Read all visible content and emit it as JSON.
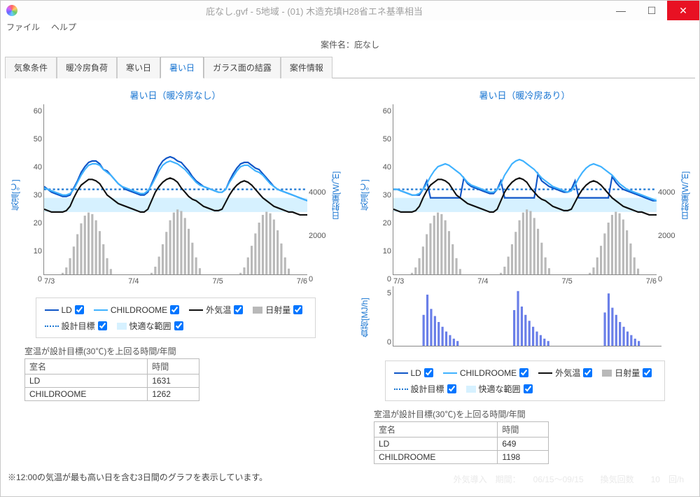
{
  "window": {
    "title": "庇なし.gvf - 5地域 - (01) 木造充填H28省エネ基準相当"
  },
  "menu": {
    "file": "ファイル",
    "help": "ヘルプ"
  },
  "case_label": "案件名：",
  "case_name": "庇なし",
  "tabs": {
    "weather": "気象条件",
    "hvac_load": "暖冷房負荷",
    "cold_day": "寒い日",
    "hot_day": "暑い日",
    "condensation": "ガラス面の結露",
    "info": "案件情報"
  },
  "chart_titles": {
    "left": "暑い日（暖冷房なし）",
    "right": "暑い日（暖冷房あり）"
  },
  "axis": {
    "temp_label": "気温[℃]",
    "radiation_label": "日射量[W/㎡]",
    "load_label": "負荷[MJ/h]"
  },
  "xticks": [
    "7/3",
    "7/4",
    "7/5",
    "7/6"
  ],
  "yticks_temp": [
    "60",
    "50",
    "40",
    "30",
    "20",
    "10",
    "0"
  ],
  "yticks_rad": [
    "4000",
    "2000",
    "0"
  ],
  "yticks_load": [
    "5",
    "0"
  ],
  "legend": {
    "ld": "LD",
    "child": "CHILDROOME",
    "outside": "外気温",
    "radiation": "日射量",
    "target": "設計目標",
    "comfort": "快適な範囲"
  },
  "summary": {
    "title": "室温が設計目標(30℃)を上回る時間/年間",
    "headers": {
      "room": "室名",
      "hours": "時間"
    },
    "left_rows": [
      {
        "room": "LD",
        "hours": "1631"
      },
      {
        "room": "CHILDROOME",
        "hours": "1262"
      }
    ],
    "right_rows": [
      {
        "room": "LD",
        "hours": "649"
      },
      {
        "room": "CHILDROOME",
        "hours": "1198"
      }
    ]
  },
  "footnote": "※12:00の気温が最も高い日を含む3日間のグラフを表示しています。",
  "faded_text": "外気導入　期間：　　06/15～09/15　　換気回数　　10　回/h",
  "chart_data": [
    {
      "id": "left_main",
      "type": "line+bar",
      "title": "暑い日（暖冷房なし）",
      "x_range": [
        "7/3 00:00",
        "7/6 00:00"
      ],
      "y_left": {
        "label": "気温[℃]",
        "range": [
          0,
          60
        ]
      },
      "y_right": {
        "label": "日射量[W/㎡]",
        "range": [
          0,
          4400
        ]
      },
      "series": [
        {
          "name": "LD",
          "axis": "left",
          "color": "#0f55c7",
          "style": "solid",
          "values": [
            31,
            30,
            29,
            28.5,
            28,
            27.5,
            27.5,
            28,
            30.5,
            33,
            36,
            38,
            39.5,
            40,
            40,
            39,
            37,
            36.5,
            35,
            33.5,
            32,
            31,
            30,
            29.5,
            29,
            28.5,
            28,
            28,
            29,
            32,
            35,
            38,
            40,
            41,
            41.5,
            41,
            40,
            39.5,
            38,
            36.5,
            34.5,
            33,
            32,
            31,
            30.5,
            30,
            29.5,
            29,
            29,
            30,
            33,
            35.5,
            37.5,
            39,
            39.5,
            39.5,
            38.5,
            37.5,
            37,
            35.5,
            34,
            32.5,
            31,
            30,
            29.5,
            29,
            28.5,
            28,
            27.5,
            27,
            26.5,
            26
          ]
        },
        {
          "name": "CHILDROOME",
          "axis": "left",
          "color": "#3fb2ff",
          "style": "solid",
          "values": [
            30.5,
            30,
            29.5,
            29,
            28.5,
            28,
            28,
            28.5,
            30,
            32.5,
            35,
            37,
            38.5,
            39,
            39,
            38.5,
            37,
            36,
            35,
            33.5,
            32,
            31,
            30.5,
            30,
            29.5,
            29,
            28.5,
            28.5,
            29.5,
            31.5,
            34,
            36.5,
            38.5,
            39.5,
            40,
            39.5,
            39,
            38,
            37,
            35.5,
            34,
            32.5,
            31.5,
            31,
            30.5,
            30,
            29.5,
            29,
            29,
            30,
            32.5,
            34.5,
            36.5,
            38,
            38.5,
            38.5,
            37.5,
            36.5,
            36,
            35,
            33.5,
            32,
            31,
            30,
            29.5,
            29,
            28.5,
            28,
            27.5,
            27,
            26.5,
            26
          ]
        },
        {
          "name": "外気温",
          "axis": "left",
          "color": "#111",
          "style": "solid",
          "values": [
            23,
            22.5,
            22,
            22,
            22,
            22,
            22.5,
            24,
            27,
            29.5,
            31.5,
            32.5,
            33.5,
            33.5,
            33,
            32,
            30,
            28,
            27,
            26,
            25,
            24.5,
            24,
            23.5,
            23,
            22.5,
            22,
            22,
            23,
            26,
            29,
            31,
            32.5,
            33.5,
            34,
            33.5,
            32.5,
            30.5,
            29,
            27.5,
            26.5,
            26,
            25,
            24,
            23.5,
            23,
            22.5,
            22.5,
            23,
            25.5,
            28,
            30,
            31.5,
            32.5,
            33,
            32.5,
            31.5,
            30,
            28.5,
            27,
            26,
            25,
            24,
            23.5,
            23,
            22.5,
            22,
            22,
            21.5,
            21,
            21,
            21
          ]
        },
        {
          "name": "設計目標",
          "axis": "left",
          "color": "#1a76d2",
          "style": "dashed",
          "constant": 30
        },
        {
          "name": "快適な範囲",
          "axis": "left",
          "type": "area",
          "color": "#d6f1ff",
          "range": [
            22,
            27
          ]
        },
        {
          "name": "日射量",
          "axis": "right",
          "type": "bar",
          "color": "#b9b9b9",
          "values": [
            0,
            0,
            0,
            0,
            0,
            40,
            180,
            420,
            720,
            1040,
            1320,
            1520,
            1600,
            1560,
            1400,
            1120,
            780,
            420,
            140,
            0,
            0,
            0,
            0,
            0,
            0,
            0,
            0,
            0,
            0,
            40,
            200,
            460,
            780,
            1100,
            1400,
            1600,
            1680,
            1640,
            1460,
            1180,
            820,
            440,
            160,
            0,
            0,
            0,
            0,
            0,
            0,
            0,
            0,
            0,
            0,
            40,
            180,
            440,
            740,
            1060,
            1340,
            1540,
            1620,
            1580,
            1420,
            1140,
            800,
            440,
            150,
            0,
            0,
            0,
            0,
            0
          ]
        }
      ]
    },
    {
      "id": "right_main",
      "type": "line+bar",
      "title": "暑い日（暖冷房あり）",
      "x_range": [
        "7/3 00:00",
        "7/6 00:00"
      ],
      "y_left": {
        "label": "気温[℃]",
        "range": [
          0,
          60
        ]
      },
      "y_right": {
        "label": "日射量[W/㎡]",
        "range": [
          0,
          4400
        ]
      },
      "series": [
        {
          "name": "LD",
          "axis": "left",
          "color": "#0f55c7",
          "style": "solid",
          "values": [
            30,
            30,
            29.5,
            29,
            28.5,
            28,
            28,
            28,
            30,
            33,
            27,
            27,
            27,
            27,
            27,
            27,
            27,
            27,
            27,
            34,
            32,
            31,
            30.5,
            30,
            29.5,
            29,
            28.5,
            28.5,
            30,
            33,
            27,
            27,
            27,
            27,
            27,
            27,
            27,
            27,
            27,
            35.5,
            33,
            32,
            31,
            30.5,
            30,
            29.5,
            29,
            29,
            30,
            33,
            27,
            27,
            27,
            27,
            27,
            27,
            27,
            27,
            27,
            34.5,
            32.5,
            31,
            30,
            29.5,
            29,
            28.5,
            28,
            27.5,
            27,
            26.5,
            26,
            26
          ]
        },
        {
          "name": "CHILDROOME",
          "axis": "left",
          "color": "#3fb2ff",
          "style": "solid",
          "values": [
            30,
            30,
            29.5,
            29,
            28.5,
            28,
            28,
            28.5,
            30,
            32,
            34.5,
            36.5,
            38,
            38.5,
            39,
            38.5,
            37.5,
            36.5,
            35.5,
            34,
            32.5,
            31.5,
            31,
            30.5,
            30,
            29.5,
            29,
            29,
            30,
            32,
            35,
            37,
            39,
            40,
            40.5,
            40,
            39,
            38,
            37,
            35.5,
            34,
            33,
            32,
            31,
            30.5,
            30,
            29.5,
            29,
            29.5,
            31.5,
            34,
            36,
            37.5,
            38.5,
            39,
            38.5,
            38,
            37,
            36,
            35,
            33.5,
            32,
            31,
            30,
            29.5,
            29,
            28.5,
            28,
            27.5,
            27,
            26.5,
            26
          ]
        },
        {
          "name": "外気温",
          "axis": "left",
          "color": "#111",
          "style": "solid",
          "values": [
            23,
            22.5,
            22,
            22,
            22,
            22,
            22.5,
            24,
            27,
            29.5,
            31.5,
            32.5,
            33.5,
            33.5,
            33,
            32,
            30,
            28,
            27,
            26,
            25,
            24.5,
            24,
            23.5,
            23,
            22.5,
            22,
            22,
            23,
            26,
            29,
            31,
            32.5,
            33.5,
            34,
            33.5,
            32.5,
            30.5,
            29,
            27.5,
            26.5,
            26,
            25,
            24,
            23.5,
            23,
            22.5,
            22.5,
            23,
            25.5,
            28,
            30,
            31.5,
            32.5,
            33,
            32.5,
            31.5,
            30,
            28.5,
            27,
            26,
            25,
            24,
            23.5,
            23,
            22.5,
            22,
            22,
            21.5,
            21,
            21,
            21
          ]
        },
        {
          "name": "設計目標",
          "axis": "left",
          "color": "#1a76d2",
          "style": "dashed",
          "constant": 30
        },
        {
          "name": "快適な範囲",
          "axis": "left",
          "type": "area",
          "color": "#d6f1ff",
          "range": [
            22,
            27
          ]
        },
        {
          "name": "日射量",
          "axis": "right",
          "type": "bar",
          "color": "#b9b9b9",
          "values": [
            0,
            0,
            0,
            0,
            0,
            40,
            180,
            420,
            720,
            1040,
            1320,
            1520,
            1600,
            1560,
            1400,
            1120,
            780,
            420,
            140,
            0,
            0,
            0,
            0,
            0,
            0,
            0,
            0,
            0,
            0,
            40,
            200,
            460,
            780,
            1100,
            1400,
            1600,
            1680,
            1640,
            1460,
            1180,
            820,
            440,
            160,
            0,
            0,
            0,
            0,
            0,
            0,
            0,
            0,
            0,
            0,
            40,
            180,
            440,
            740,
            1060,
            1340,
            1540,
            1620,
            1580,
            1420,
            1140,
            800,
            440,
            150,
            0,
            0,
            0,
            0,
            0
          ]
        }
      ]
    },
    {
      "id": "right_load",
      "type": "bar",
      "title": "",
      "y_left": {
        "label": "負荷[MJ/h]",
        "range": [
          0,
          5
        ]
      },
      "categories_note": "hourly over 7/3-7/6",
      "series": [
        {
          "name": "負荷",
          "color": "#6a7fe8",
          "values": [
            0,
            0,
            0,
            0,
            0,
            0,
            0,
            0,
            2.6,
            4.3,
            3.1,
            2.5,
            2.0,
            1.6,
            1.2,
            0.9,
            0.6,
            0.4,
            0,
            0,
            0,
            0,
            0,
            0,
            0,
            0,
            0,
            0,
            0,
            0,
            0,
            0,
            3.0,
            4.6,
            3.3,
            2.6,
            2.1,
            1.6,
            1.2,
            0.9,
            0.6,
            0.4,
            0,
            0,
            0,
            0,
            0,
            0,
            0,
            0,
            0,
            0,
            0,
            0,
            0,
            0,
            2.8,
            4.4,
            3.2,
            2.6,
            2.0,
            1.6,
            1.2,
            0.9,
            0.6,
            0.4,
            0,
            0,
            0,
            0,
            0,
            0
          ]
        }
      ]
    }
  ]
}
